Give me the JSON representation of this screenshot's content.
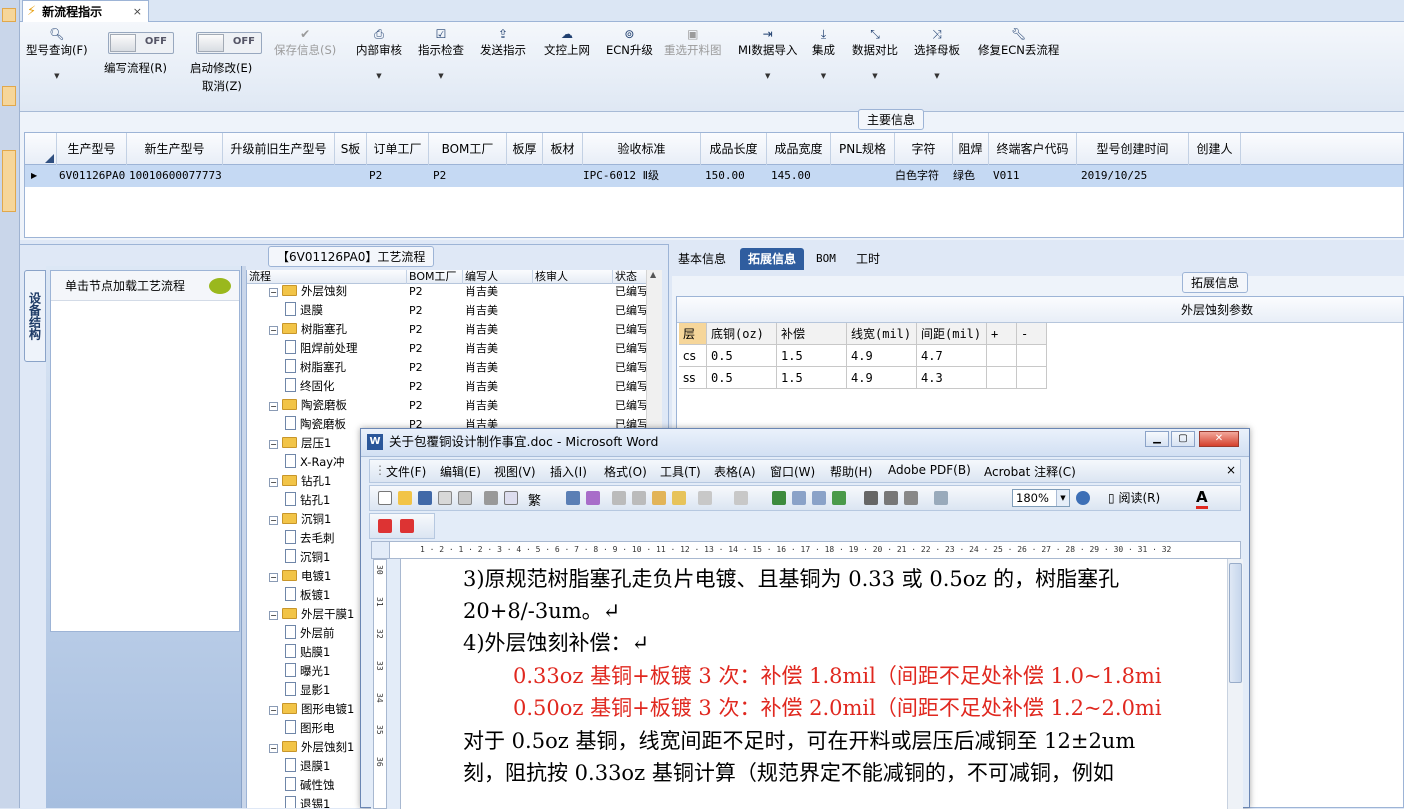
{
  "doc_tab": {
    "title": "新流程指示",
    "close": "×"
  },
  "toolbar": {
    "model_query": "型号查询(F)",
    "write_flow_toggle": "OFF",
    "write_flow": "编写流程(R)",
    "start_modify_toggle": "OFF",
    "start_modify": "启动修改(E)",
    "cancel": "取消(Z)",
    "save_info": "保存信息(S)",
    "internal_review": "内部审核",
    "instruction_check": "指示检查",
    "send_instruction": "发送指示",
    "doc_control_upload": "文控上网",
    "ecn_upgrade": "ECN升级",
    "reselect_cut_chart": "重选开料图",
    "mi_import": "MI数据导入",
    "integrate": "集成",
    "data_compare": "数据对比",
    "select_master": "选择母板",
    "fix_ecn_flow": "修复ECN丢流程"
  },
  "main_info": {
    "caption": "主要信息",
    "columns": [
      "生产型号",
      "新生产型号",
      "升级前旧生产型号",
      "S板",
      "订单工厂",
      "BOM工厂",
      "板厚",
      "板材",
      "验收标准",
      "成品长度",
      "成品宽度",
      "PNL规格",
      "字符",
      "阻焊",
      "终端客户代码",
      "型号创建时间",
      "创建人"
    ],
    "row": [
      "6V01126PA0",
      "10010600077773",
      "",
      "",
      "P2",
      "P2",
      "",
      "",
      "IPC-6012 Ⅱ级",
      "150.00",
      "145.00",
      "",
      "白色字符",
      "绿色",
      "V011",
      "2019/10/25",
      ""
    ]
  },
  "process": {
    "caption": "【6V01126PA0】工艺流程",
    "side_tab": "设备结构",
    "node_hint": "单击节点加载工艺流程",
    "columns": [
      "流程",
      "BOM工厂",
      "编写人",
      "核审人",
      "状态"
    ],
    "rows": [
      {
        "name": "外层蚀刻",
        "folder": true,
        "bom": "P2",
        "writer": "肖吉美",
        "status": "已编写"
      },
      {
        "name": "退膜",
        "folder": false,
        "bom": "P2",
        "writer": "肖吉美",
        "status": "已编写"
      },
      {
        "name": "树脂塞孔",
        "folder": true,
        "bom": "P2",
        "writer": "肖吉美",
        "status": "已编写"
      },
      {
        "name": "阻焊前处理",
        "folder": false,
        "bom": "P2",
        "writer": "肖吉美",
        "status": "已编写"
      },
      {
        "name": "树脂塞孔",
        "folder": false,
        "bom": "P2",
        "writer": "肖吉美",
        "status": "已编写"
      },
      {
        "name": "终固化",
        "folder": false,
        "bom": "P2",
        "writer": "肖吉美",
        "status": "已编写"
      },
      {
        "name": "陶瓷磨板",
        "folder": true,
        "bom": "P2",
        "writer": "肖吉美",
        "status": "已编写"
      },
      {
        "name": "陶瓷磨板",
        "folder": false,
        "bom": "P2",
        "writer": "肖吉美",
        "status": "已编写"
      },
      {
        "name": "层压1",
        "folder": true,
        "bom": "",
        "writer": "",
        "status": ""
      },
      {
        "name": "X-Ray冲",
        "folder": false,
        "bom": "",
        "writer": "",
        "status": ""
      },
      {
        "name": "钻孔1",
        "folder": true,
        "bom": "",
        "writer": "",
        "status": ""
      },
      {
        "name": "钻孔1",
        "folder": false,
        "bom": "",
        "writer": "",
        "status": ""
      },
      {
        "name": "沉铜1",
        "folder": true,
        "bom": "",
        "writer": "",
        "status": ""
      },
      {
        "name": "去毛刺",
        "folder": false,
        "bom": "",
        "writer": "",
        "status": ""
      },
      {
        "name": "沉铜1",
        "folder": false,
        "bom": "",
        "writer": "",
        "status": ""
      },
      {
        "name": "电镀1",
        "folder": true,
        "bom": "",
        "writer": "",
        "status": ""
      },
      {
        "name": "板镀1",
        "folder": false,
        "bom": "",
        "writer": "",
        "status": ""
      },
      {
        "name": "外层干膜1",
        "folder": true,
        "bom": "",
        "writer": "",
        "status": ""
      },
      {
        "name": "外层前",
        "folder": false,
        "bom": "",
        "writer": "",
        "status": ""
      },
      {
        "name": "贴膜1",
        "folder": false,
        "bom": "",
        "writer": "",
        "status": ""
      },
      {
        "name": "曝光1",
        "folder": false,
        "bom": "",
        "writer": "",
        "status": ""
      },
      {
        "name": "显影1",
        "folder": false,
        "bom": "",
        "writer": "",
        "status": ""
      },
      {
        "name": "图形电镀1",
        "folder": true,
        "bom": "",
        "writer": "",
        "status": ""
      },
      {
        "name": "图形电",
        "folder": false,
        "bom": "",
        "writer": "",
        "status": ""
      },
      {
        "name": "外层蚀刻1",
        "folder": true,
        "bom": "",
        "writer": "",
        "status": ""
      },
      {
        "name": "退膜1",
        "folder": false,
        "bom": "",
        "writer": "",
        "status": ""
      },
      {
        "name": "碱性蚀",
        "folder": false,
        "bom": "",
        "writer": "",
        "status": ""
      },
      {
        "name": "退锡1",
        "folder": false,
        "bom": "",
        "writer": "",
        "status": ""
      }
    ]
  },
  "detail": {
    "tabs": [
      "基本信息",
      "拓展信息",
      "BOM",
      "工时"
    ],
    "caption": "拓展信息",
    "table_title": "外层蚀刻参数",
    "columns": [
      "层",
      "底铜(oz)",
      "补偿",
      "线宽(mil)",
      "间距(mil)",
      "+",
      "-"
    ],
    "rows": [
      [
        "cs",
        "0.5",
        "1.5",
        "4.9",
        "4.7",
        "",
        ""
      ],
      [
        "ss",
        "0.5",
        "1.5",
        "4.9",
        "4.3",
        "",
        ""
      ]
    ]
  },
  "word": {
    "title": "关于包覆铜设计制作事宜.doc - Microsoft Word",
    "icon": "W",
    "menus": [
      "文件(F)",
      "编辑(E)",
      "视图(V)",
      "插入(I)",
      "格式(O)",
      "工具(T)",
      "表格(A)",
      "窗口(W)",
      "帮助(H)",
      "Adobe PDF(B)",
      "Acrobat 注释(C)"
    ],
    "menu_close": "×",
    "zoom": "180%",
    "read_button": "阅读(R)",
    "font_label": "繁",
    "ruler": "1 · 2 · 1 · 2 · 3 · 4 · 5 · 6 · 7 · 8 · 9 · 10 · 11 · 12 · 13 · 14 · 15 · 16 · 17 · 18 · 19 · 20 · 21 · 22 · 23 · 24 · 25 · 26 · 27 · 28 · 29 · 30 · 31 · 32",
    "vruler": [
      "30",
      "31",
      "32",
      "33",
      "34",
      "35",
      "36"
    ],
    "lines": [
      "3)原规范树脂塞孔走负片电镀、且基铜为 0.33 或 0.5oz 的，树脂塞孔",
      "20+8/-3um。↵",
      "4)外层蚀刻补偿：↵",
      "0.33oz 基铜+板镀 3 次：补偿 1.8mil（间距不足处补偿 1.0~1.8mi",
      "0.50oz 基铜+板镀 3 次：补偿 2.0mil（间距不足处补偿 1.2~2.0mi",
      "对于 0.5oz 基铜，线宽间距不足时，可在开料或层压后减铜至 12±2um",
      "刻，阻抗按 0.33oz 基铜计算（规范界定不能减铜的，不可减铜，例如"
    ]
  }
}
